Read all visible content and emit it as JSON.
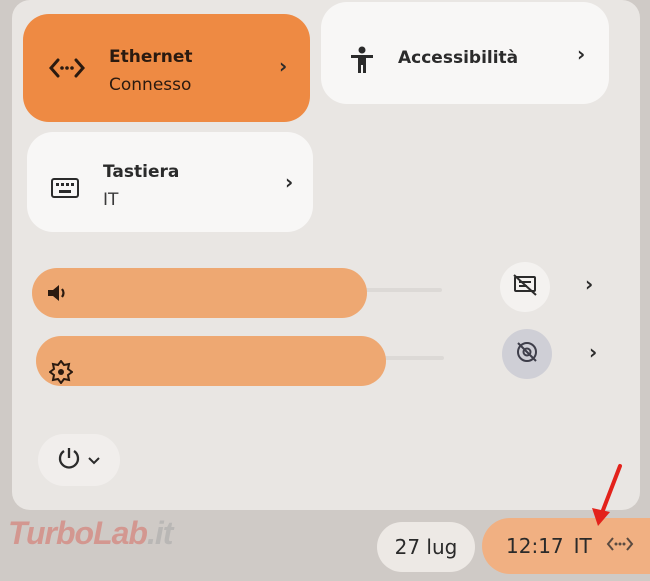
{
  "tiles": {
    "ethernet": {
      "title": "Ethernet",
      "subtitle": "Connesso",
      "icon": "ethernet-icon"
    },
    "accessibility": {
      "title": "Accessibilità",
      "icon": "accessibility-icon"
    },
    "keyboard": {
      "title": "Tastiera",
      "subtitle": "IT",
      "icon": "keyboard-icon"
    }
  },
  "sliders": {
    "volume": {
      "icon": "volume-icon",
      "level": 0.75
    },
    "brightness": {
      "icon": "brightness-icon",
      "level": 0.8
    }
  },
  "side_buttons": {
    "screen_off": {
      "icon": "screen-off-icon"
    },
    "camera_off": {
      "icon": "camera-off-icon"
    }
  },
  "power": {
    "icon": "power-icon"
  },
  "shelf": {
    "date": "27 lug",
    "time": "12:17",
    "input_method": "IT",
    "network_icon": "ethernet-icon"
  },
  "watermark": {
    "text_main": "TurboLab",
    "text_tail": ".it"
  },
  "colors": {
    "accent": "#ee8a43",
    "slider": "#eea872",
    "arrow": "#e3221b"
  }
}
